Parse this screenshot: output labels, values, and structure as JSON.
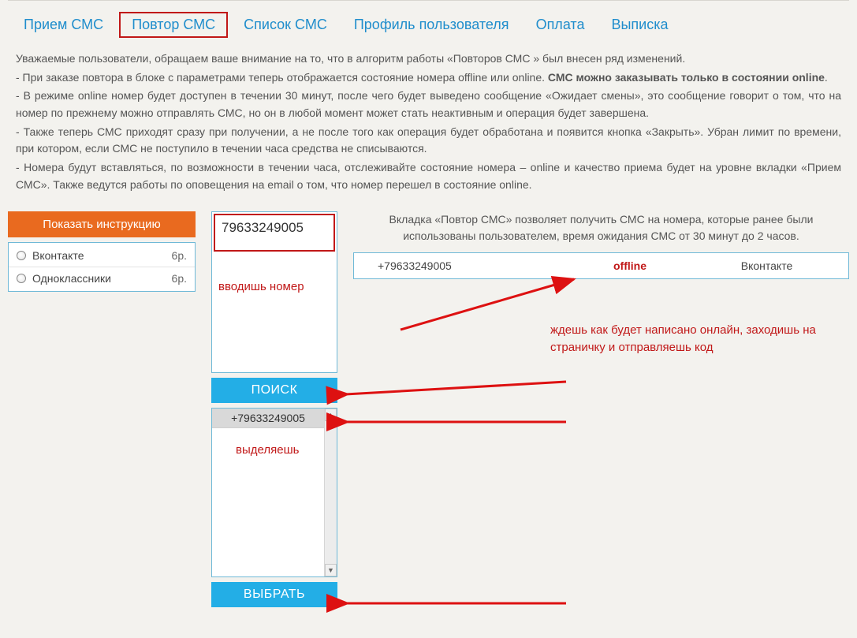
{
  "nav": {
    "items": [
      "Прием СМС",
      "Повтор СМС",
      "Список СМС",
      "Профиль пользователя",
      "Оплата",
      "Выписка"
    ],
    "active_index": 1
  },
  "info": {
    "p1": "Уважаемые пользователи, обращаем ваше внимание на то, что в алгоритм работы «Повторов СМС » был внесен ряд изменений.",
    "p2a": "- При заказе повтора в блоке с параметрами теперь отображается состояние номера offline или online. ",
    "p2b": "СМС можно заказывать только в состоянии online",
    "p2c": ".",
    "p3": "- В режиме online номер будет доступен в течении 30 минут, после чего будет выведено сообщение «Ожидает смены», это сообщение говорит о том, что на номер по прежнему можно отправлять СМС, но он в любой момент может стать неактивным и операция будет завершена.",
    "p4": "- Также теперь СМС приходят сразу при получении, а не после того как операция будет обработана и появится кнопка «Закрыть». Убран лимит по времени, при котором, если СМС не поступило в течении часа средства не списываются.",
    "p5": "- Номера будут вставляться, по возможности в течении часа, отслеживайте состояние номера – online и качество приема будет на уровне вкладки «Прием СМС». Также ведутся работы по оповещения на email о том, что номер перешел в состояние online."
  },
  "instruction_button": "Показать инструкцию",
  "services": [
    {
      "name": "Вконтакте",
      "price": "6р."
    },
    {
      "name": "Одноклассники",
      "price": "6р."
    }
  ],
  "phone_input_value": "79633249005",
  "annotation_input": "вводишь номер",
  "search_button": "ПОИСК",
  "list_item": "+79633249005",
  "annotation_select": "выделяешь",
  "select_button": "ВЫБРАТЬ",
  "intro": "Вкладка «Повтор СМС» позволяет получить СМС на номера, которые ранее были использованы пользователем, время ожидания СМС от 30 минут до 2 часов.",
  "status": {
    "phone": "+79633249005",
    "state": "offline",
    "service": "Вконтакте"
  },
  "annotation_wait": "ждешь как будет написано онлайн, заходишь на страничку и отправляешь код"
}
